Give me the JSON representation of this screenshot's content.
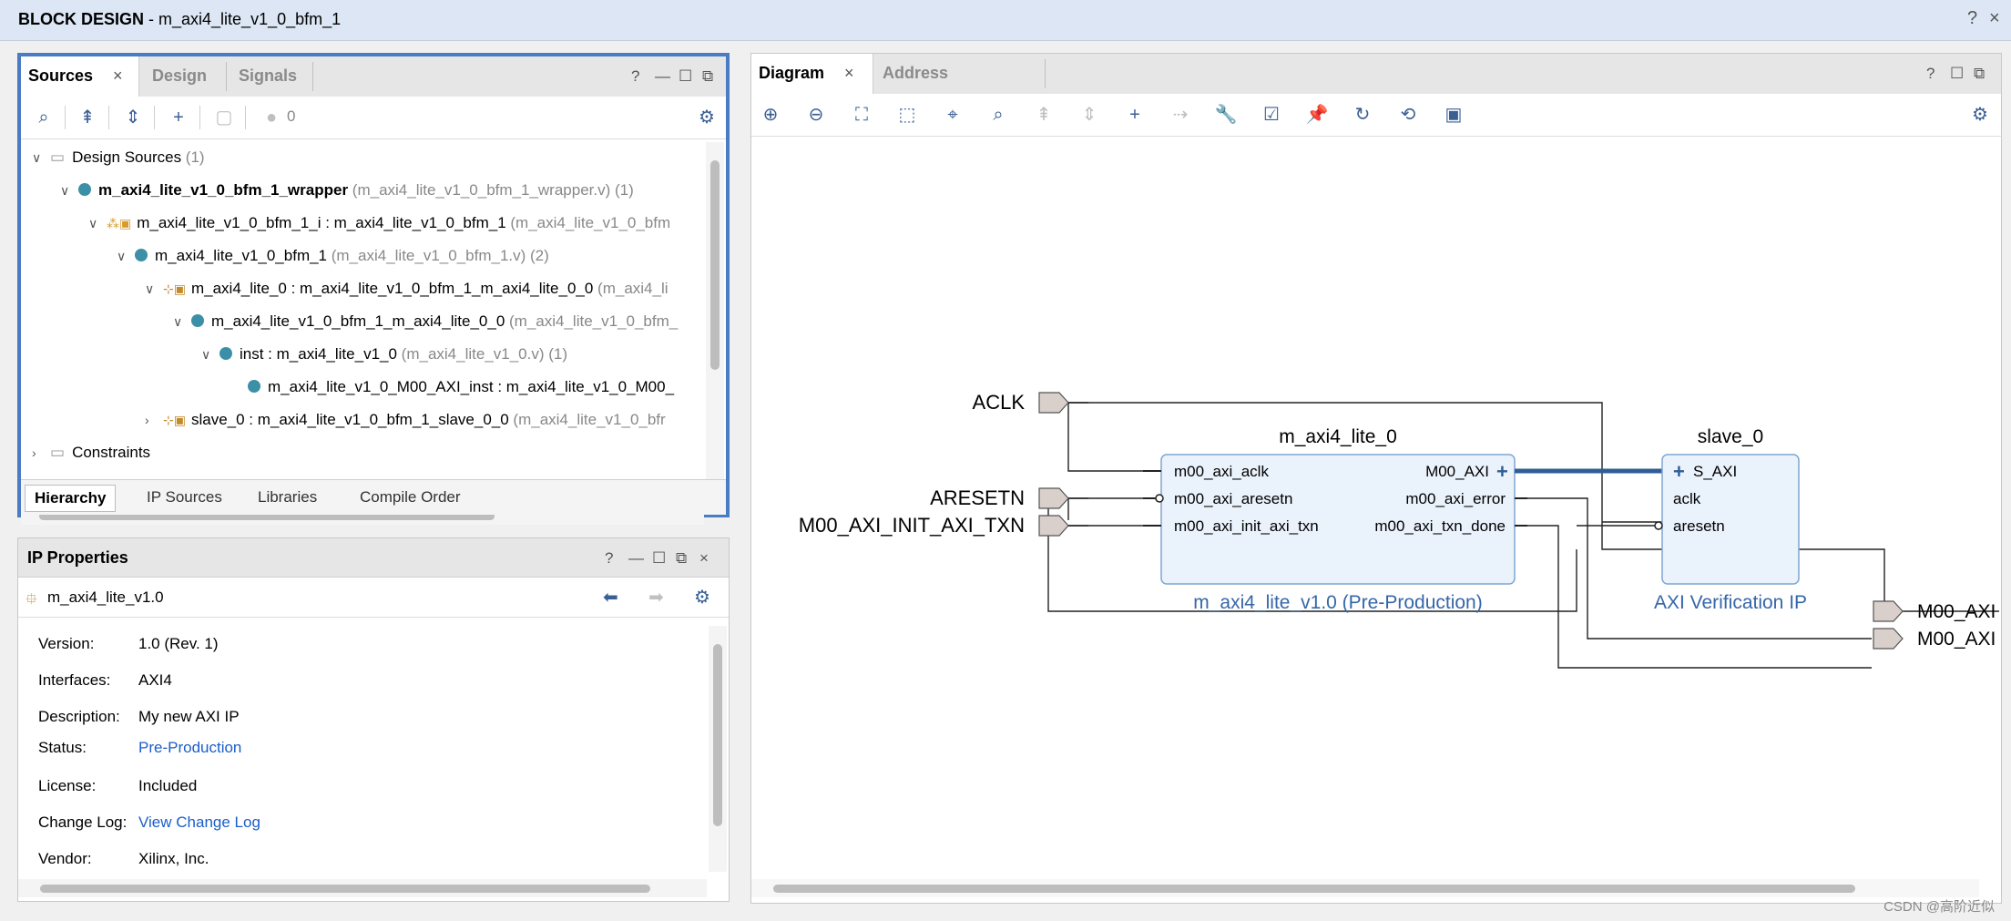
{
  "window": {
    "title_bold": "BLOCK DESIGN",
    "title_rest": " - m_axi4_lite_v1_0_bfm_1",
    "help": "?",
    "close": "×"
  },
  "sources": {
    "tabs": [
      "Sources",
      "Design",
      "Signals"
    ],
    "toolbar_count": "0",
    "tree": [
      {
        "indent": 0,
        "arrow": "∨",
        "name": "Design Sources",
        "extra": " (1)",
        "bold": false,
        "icon": "folder"
      },
      {
        "indent": 1,
        "arrow": "∨",
        "name": "m_axi4_lite_v1_0_bfm_1_wrapper",
        "extra": " (m_axi4_lite_v1_0_bfm_1_wrapper.v) (1)",
        "bold": true,
        "icon": "dot"
      },
      {
        "indent": 2,
        "arrow": "∨",
        "name": "m_axi4_lite_v1_0_bfm_1_i : m_axi4_lite_v1_0_bfm_1",
        "extra": " (m_axi4_lite_v1_0_bfm",
        "bold": false,
        "icon": "bd"
      },
      {
        "indent": 3,
        "arrow": "∨",
        "name": "m_axi4_lite_v1_0_bfm_1",
        "extra": " (m_axi4_lite_v1_0_bfm_1.v) (2)",
        "bold": false,
        "icon": "dot"
      },
      {
        "indent": 4,
        "arrow": "∨",
        "name": "m_axi4_lite_0 : m_axi4_lite_v1_0_bfm_1_m_axi4_lite_0_0",
        "extra": " (m_axi4_li",
        "bold": false,
        "icon": "ip"
      },
      {
        "indent": 5,
        "arrow": "∨",
        "name": "m_axi4_lite_v1_0_bfm_1_m_axi4_lite_0_0",
        "extra": " (m_axi4_lite_v1_0_bfm_",
        "bold": false,
        "icon": "dot"
      },
      {
        "indent": 6,
        "arrow": "∨",
        "name": "inst : m_axi4_lite_v1_0",
        "extra": " (m_axi4_lite_v1_0.v) (1)",
        "bold": false,
        "icon": "dot"
      },
      {
        "indent": 7,
        "arrow": "",
        "name": "m_axi4_lite_v1_0_M00_AXI_inst : m_axi4_lite_v1_0_M00_",
        "extra": "",
        "bold": false,
        "icon": "dot"
      },
      {
        "indent": 4,
        "arrow": "›",
        "name": "slave_0 : m_axi4_lite_v1_0_bfm_1_slave_0_0",
        "extra": " (m_axi4_lite_v1_0_bfr",
        "bold": false,
        "icon": "ip"
      },
      {
        "indent": 0,
        "arrow": "›",
        "name": "Constraints",
        "extra": "",
        "bold": false,
        "icon": "folder"
      }
    ],
    "bottom_tabs": [
      "Hierarchy",
      "IP Sources",
      "Libraries",
      "Compile Order"
    ]
  },
  "ip_properties": {
    "title": "IP Properties",
    "ip_name": "m_axi4_lite_v1.0",
    "props": [
      {
        "key": "Version:",
        "value": "1.0 (Rev. 1)",
        "link": false
      },
      {
        "key": "Interfaces:",
        "value": "AXI4",
        "link": false
      },
      {
        "key": "Description:",
        "value": "My new AXI IP",
        "link": false
      },
      {
        "key": "Status:",
        "value": "Pre-Production",
        "link": true
      },
      {
        "key": "License:",
        "value": "Included",
        "link": false
      },
      {
        "key": "Change Log:",
        "value": "View Change Log",
        "link": true
      },
      {
        "key": "Vendor:",
        "value": "Xilinx, Inc.",
        "link": false
      }
    ]
  },
  "diagram": {
    "tabs": [
      "Diagram",
      "Address Editor"
    ],
    "ports_in": [
      "ACLK",
      "ARESETN",
      "M00_AXI_INIT_AXI_TXN"
    ],
    "ports_out": [
      "M00_AXI",
      "M00_AXI"
    ],
    "master": {
      "name": "m_axi4_lite_0",
      "subtitle": "m_axi4_lite_v1.0 (Pre-Production)",
      "left_pins": [
        "m00_axi_aclk",
        "m00_axi_aresetn",
        "m00_axi_init_axi_txn"
      ],
      "right_pins": [
        "M00_AXI",
        "m00_axi_error",
        "m00_axi_txn_done"
      ]
    },
    "slave": {
      "name": "slave_0",
      "subtitle": "AXI Verification IP",
      "pins": [
        "S_AXI",
        "aclk",
        "aresetn"
      ]
    }
  },
  "watermark": "CSDN @高阶近似",
  "colors": {
    "accent": "#4a7cc4",
    "block_fill": "#eaf2fb",
    "block_stroke": "#7ea6d2",
    "link": "#1b5ec9",
    "subtitle": "#3566a8"
  }
}
